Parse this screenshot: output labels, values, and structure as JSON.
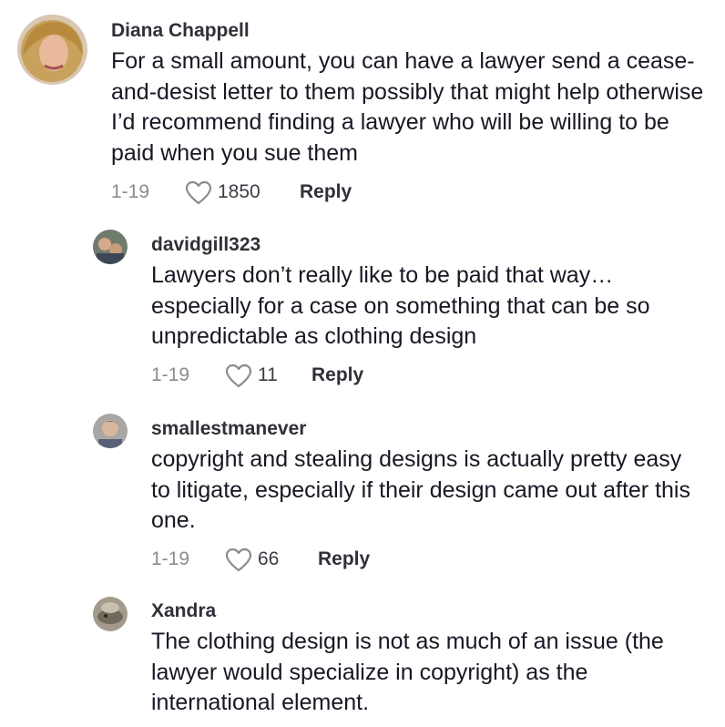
{
  "comments": [
    {
      "username": "Diana Chappell",
      "text": "For a small amount, you can have a lawyer send a cease-and-desist letter to them possibly that might help otherwise I’d recommend finding a lawyer who will be willing to be paid when you sue them",
      "date": "1-19",
      "likes": "1850",
      "reply_label": "Reply"
    },
    {
      "username": "davidgill323",
      "text": "Lawyers don’t really like to be paid that way… especially for a case on something that can be so unpredictable as clothing design",
      "date": "1-19",
      "likes": "11",
      "reply_label": "Reply"
    },
    {
      "username": "smallestmanever",
      "text": "copyright and stealing designs is actually pretty easy to litigate, especially if their design came out after this one.",
      "date": "1-19",
      "likes": "66",
      "reply_label": "Reply"
    },
    {
      "username": "Xandra",
      "text": "The clothing design is not as much of an issue (the lawyer would specialize in copyright) as the international element."
    }
  ],
  "icons": {
    "like": "heart-outline-icon"
  },
  "colors": {
    "text": "#161823",
    "secondary": "#8a8b91"
  }
}
